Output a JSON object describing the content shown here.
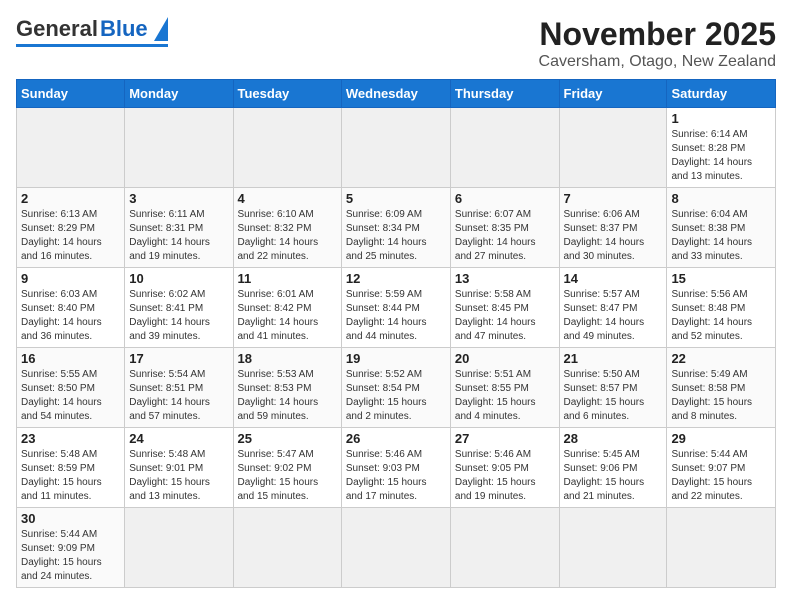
{
  "logo": {
    "general": "General",
    "blue": "Blue"
  },
  "header": {
    "month": "November 2025",
    "location": "Caversham, Otago, New Zealand"
  },
  "days_of_week": [
    "Sunday",
    "Monday",
    "Tuesday",
    "Wednesday",
    "Thursday",
    "Friday",
    "Saturday"
  ],
  "weeks": [
    [
      {
        "day": "",
        "info": ""
      },
      {
        "day": "",
        "info": ""
      },
      {
        "day": "",
        "info": ""
      },
      {
        "day": "",
        "info": ""
      },
      {
        "day": "",
        "info": ""
      },
      {
        "day": "",
        "info": ""
      },
      {
        "day": "1",
        "info": "Sunrise: 6:14 AM\nSunset: 8:28 PM\nDaylight: 14 hours and 13 minutes."
      }
    ],
    [
      {
        "day": "2",
        "info": "Sunrise: 6:13 AM\nSunset: 8:29 PM\nDaylight: 14 hours and 16 minutes."
      },
      {
        "day": "3",
        "info": "Sunrise: 6:11 AM\nSunset: 8:31 PM\nDaylight: 14 hours and 19 minutes."
      },
      {
        "day": "4",
        "info": "Sunrise: 6:10 AM\nSunset: 8:32 PM\nDaylight: 14 hours and 22 minutes."
      },
      {
        "day": "5",
        "info": "Sunrise: 6:09 AM\nSunset: 8:34 PM\nDaylight: 14 hours and 25 minutes."
      },
      {
        "day": "6",
        "info": "Sunrise: 6:07 AM\nSunset: 8:35 PM\nDaylight: 14 hours and 27 minutes."
      },
      {
        "day": "7",
        "info": "Sunrise: 6:06 AM\nSunset: 8:37 PM\nDaylight: 14 hours and 30 minutes."
      },
      {
        "day": "8",
        "info": "Sunrise: 6:04 AM\nSunset: 8:38 PM\nDaylight: 14 hours and 33 minutes."
      }
    ],
    [
      {
        "day": "9",
        "info": "Sunrise: 6:03 AM\nSunset: 8:40 PM\nDaylight: 14 hours and 36 minutes."
      },
      {
        "day": "10",
        "info": "Sunrise: 6:02 AM\nSunset: 8:41 PM\nDaylight: 14 hours and 39 minutes."
      },
      {
        "day": "11",
        "info": "Sunrise: 6:01 AM\nSunset: 8:42 PM\nDaylight: 14 hours and 41 minutes."
      },
      {
        "day": "12",
        "info": "Sunrise: 5:59 AM\nSunset: 8:44 PM\nDaylight: 14 hours and 44 minutes."
      },
      {
        "day": "13",
        "info": "Sunrise: 5:58 AM\nSunset: 8:45 PM\nDaylight: 14 hours and 47 minutes."
      },
      {
        "day": "14",
        "info": "Sunrise: 5:57 AM\nSunset: 8:47 PM\nDaylight: 14 hours and 49 minutes."
      },
      {
        "day": "15",
        "info": "Sunrise: 5:56 AM\nSunset: 8:48 PM\nDaylight: 14 hours and 52 minutes."
      }
    ],
    [
      {
        "day": "16",
        "info": "Sunrise: 5:55 AM\nSunset: 8:50 PM\nDaylight: 14 hours and 54 minutes."
      },
      {
        "day": "17",
        "info": "Sunrise: 5:54 AM\nSunset: 8:51 PM\nDaylight: 14 hours and 57 minutes."
      },
      {
        "day": "18",
        "info": "Sunrise: 5:53 AM\nSunset: 8:53 PM\nDaylight: 14 hours and 59 minutes."
      },
      {
        "day": "19",
        "info": "Sunrise: 5:52 AM\nSunset: 8:54 PM\nDaylight: 15 hours and 2 minutes."
      },
      {
        "day": "20",
        "info": "Sunrise: 5:51 AM\nSunset: 8:55 PM\nDaylight: 15 hours and 4 minutes."
      },
      {
        "day": "21",
        "info": "Sunrise: 5:50 AM\nSunset: 8:57 PM\nDaylight: 15 hours and 6 minutes."
      },
      {
        "day": "22",
        "info": "Sunrise: 5:49 AM\nSunset: 8:58 PM\nDaylight: 15 hours and 8 minutes."
      }
    ],
    [
      {
        "day": "23",
        "info": "Sunrise: 5:48 AM\nSunset: 8:59 PM\nDaylight: 15 hours and 11 minutes."
      },
      {
        "day": "24",
        "info": "Sunrise: 5:48 AM\nSunset: 9:01 PM\nDaylight: 15 hours and 13 minutes."
      },
      {
        "day": "25",
        "info": "Sunrise: 5:47 AM\nSunset: 9:02 PM\nDaylight: 15 hours and 15 minutes."
      },
      {
        "day": "26",
        "info": "Sunrise: 5:46 AM\nSunset: 9:03 PM\nDaylight: 15 hours and 17 minutes."
      },
      {
        "day": "27",
        "info": "Sunrise: 5:46 AM\nSunset: 9:05 PM\nDaylight: 15 hours and 19 minutes."
      },
      {
        "day": "28",
        "info": "Sunrise: 5:45 AM\nSunset: 9:06 PM\nDaylight: 15 hours and 21 minutes."
      },
      {
        "day": "29",
        "info": "Sunrise: 5:44 AM\nSunset: 9:07 PM\nDaylight: 15 hours and 22 minutes."
      }
    ],
    [
      {
        "day": "30",
        "info": "Sunrise: 5:44 AM\nSunset: 9:09 PM\nDaylight: 15 hours and 24 minutes."
      },
      {
        "day": "",
        "info": ""
      },
      {
        "day": "",
        "info": ""
      },
      {
        "day": "",
        "info": ""
      },
      {
        "day": "",
        "info": ""
      },
      {
        "day": "",
        "info": ""
      },
      {
        "day": "",
        "info": ""
      }
    ]
  ]
}
